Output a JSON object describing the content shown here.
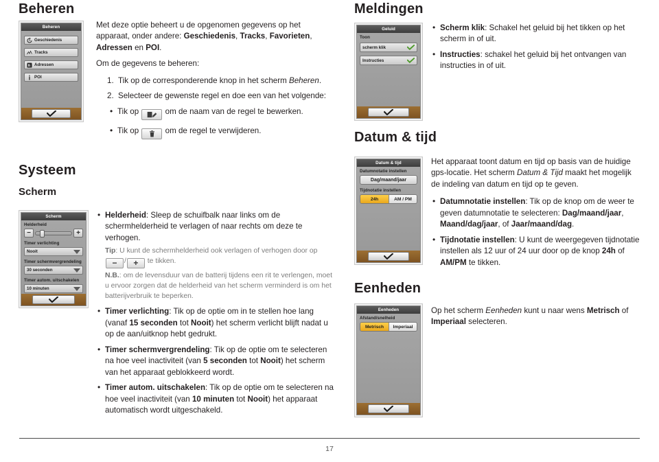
{
  "page": {
    "number": "17"
  },
  "sections": {
    "beheren": {
      "title": "Beheren",
      "device": {
        "title": "Beheren",
        "rows": [
          {
            "label": "Geschiedenis",
            "icon": "history-icon"
          },
          {
            "label": "Tracks",
            "icon": "tracks-icon"
          },
          {
            "label": "Adressen",
            "icon": "addresses-icon"
          },
          {
            "label": "POI",
            "icon": "poi-icon"
          }
        ],
        "ok": "check-icon"
      },
      "intro_1": "Met deze optie beheert u de opgenomen gegevens op het apparaat, onder andere: ",
      "intro_b1": "Geschiedenis",
      "intro_2": ", ",
      "intro_b2": "Tracks",
      "intro_3": ", ",
      "intro_b3": "Favorieten",
      "intro_4": ", ",
      "intro_b4": "Adressen",
      "intro_5": " en ",
      "intro_b5": "POI",
      "intro_6": ".",
      "intro_line2": "Om de gegevens te beheren:",
      "step1_a": "Tik op de corresponderende knop in het scherm ",
      "step1_em": "Beheren",
      "step1_b": ".",
      "step2": "Selecteer de gewenste regel en doe een van het volgende:",
      "sub1_a": "Tik op",
      "sub1_b": "om de naam van de regel te bewerken.",
      "sub2_a": "Tik op",
      "sub2_b": "om de regel te verwijderen."
    },
    "systeem": {
      "title": "Systeem",
      "scherm_title": "Scherm",
      "device": {
        "title": "Scherm",
        "brightness_label": "Helderheid",
        "minus": "−",
        "plus": "+",
        "fields": [
          {
            "label": "Timer verlichting",
            "value": "Nooit"
          },
          {
            "label": "Timer schermvergrendeling",
            "value": "30 seconden"
          },
          {
            "label": "Timer autom. uitschakelen",
            "value": "10 minuten"
          }
        ],
        "ok": "check-icon"
      },
      "b1_strong": "Helderheid",
      "b1_text": ": Sleep de schuifbalk naar links om de schermhelderheid te verlagen of naar rechts om deze te verhogen.",
      "tip_strong": "Tip",
      "tip_a": ": U kunt de schermhelderheid ook verlagen of verhogen door op",
      "tip_sep": "/",
      "tip_b": "te tikken.",
      "nb_strong": "N.B.",
      "nb_text": ": om de levensduur van de batterij tijdens een rit te verlengen, moet u ervoor zorgen dat de helderheid van het scherm verminderd is om het batterijverbruik te beperken.",
      "b2_strong": "Timer verlichting",
      "b2_a": ": Tik op de optie om in te stellen hoe lang (vanaf ",
      "b2_v1": "15 seconden",
      "b2_b": " tot ",
      "b2_v2": "Nooit",
      "b2_c": ") het scherm verlicht blijft nadat u op de aan/uitknop hebt gedrukt.",
      "b3_strong": "Timer schermvergrendeling",
      "b3_a": ": Tik op de optie om te selecteren na hoe veel inactiviteit (van ",
      "b3_v1": "5 seconden",
      "b3_b": " tot ",
      "b3_v2": "Nooit",
      "b3_c": ") het scherm van het apparaat geblokkeerd wordt.",
      "b4_strong": "Timer autom. uitschakelen",
      "b4_a": ": Tik op de optie om te selecteren na hoe veel inactiviteit (van ",
      "b4_v1": "10 minuten",
      "b4_b": " tot ",
      "b4_v2": "Nooit",
      "b4_c": ") het apparaat automatisch wordt uitgeschakeld."
    },
    "meldingen": {
      "title": "Meldingen",
      "device": {
        "title": "Geluid",
        "group_label": "Toon",
        "rows": [
          {
            "label": "scherm klik",
            "checked": true
          },
          {
            "label": "Instructies",
            "checked": true
          }
        ],
        "ok": "check-icon"
      },
      "b1_strong": "Scherm klik",
      "b1_text": ": Schakel het geluid bij het tikken op het scherm in of uit.",
      "b2_strong": "Instructies",
      "b2_text": ": schakel het geluid bij het ontvangen van instructies in of uit."
    },
    "datumtijd": {
      "title": "Datum & tijd",
      "device": {
        "title": "Datum & tijd",
        "date_label": "Datumnotatie instellen",
        "date_value": "Dag/maand/jaar",
        "time_label": "Tijdnotatie instellen",
        "time_options": [
          {
            "label": "24h",
            "selected": true
          },
          {
            "label": "AM / PM",
            "selected": false
          }
        ],
        "ok": "check-icon"
      },
      "intro_a": "Het apparaat toont datum en tijd op basis van de huidige gps-locatie. Het scherm ",
      "intro_em": "Datum & Tijd",
      "intro_b": " maakt het mogelijk de indeling van datum en tijd op te geven.",
      "b1_strong": "Datumnotatie instellen",
      "b1_a": ": Tik op de knop om de weer te geven datumnotatie te selecteren: ",
      "b1_v1": "Dag/maand/jaar",
      "b1_b": ", ",
      "b1_v2": "Maand/dag/jaar",
      "b1_c": ", of ",
      "b1_v3": "Jaar/maand/dag",
      "b1_d": ".",
      "b2_strong": "Tijdnotatie instellen",
      "b2_a": ": U kunt de weergegeven tijdnotatie instellen als 12 uur of 24 uur door op de knop ",
      "b2_v1": "24h",
      "b2_b": " of ",
      "b2_v2": "AM/PM",
      "b2_c": " te tikken."
    },
    "eenheden": {
      "title": "Eenheden",
      "device": {
        "title": "Eenheden",
        "group_label": "Afstand/snelheid",
        "options": [
          {
            "label": "Metrisch",
            "selected": true
          },
          {
            "label": "Imperiaal",
            "selected": false
          }
        ],
        "ok": "check-icon"
      },
      "text_a": "Op het scherm ",
      "text_em": "Eenheden",
      "text_b": " kunt u naar wens ",
      "text_v1": "Metrisch",
      "text_c": " of ",
      "text_v2": "Imperiaal",
      "text_d": " selecteren."
    }
  },
  "colors": {
    "accent_gold": "#eaa81d",
    "device_bg": "#9d9d9d",
    "device_footer": "#8a5c27",
    "check_green": "#4d9a29",
    "text": "#231f20",
    "note": "#7d7d7d"
  }
}
